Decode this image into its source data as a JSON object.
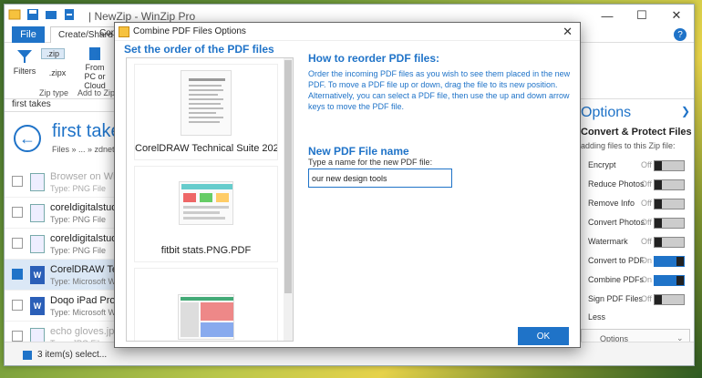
{
  "app": {
    "title": "| NewZip - WinZip Pro",
    "window_controls": [
      "—",
      "☐",
      "✕"
    ]
  },
  "ribbon": {
    "tab_file": "File",
    "tab_create_share": "Create/Share",
    "tab_copy": "Copy",
    "help": "?",
    "filters_label": "Filters",
    "zip_label": ".zip",
    "zipx_label": ".zipx",
    "from_pc_label": "From PC or Cloud",
    "group_zip_type": "Zip type",
    "group_add_to_zip": "Add to Zip"
  },
  "left_nav": {
    "tab_label": "first takes",
    "big_title": "first takes",
    "breadcrumb": "Files  »  ...  »  zdnet"
  },
  "files": [
    {
      "name": "Browser on Win",
      "type": "Type: PNG File",
      "icon": "image-file-icon",
      "dim": true,
      "selected": false
    },
    {
      "name": "coreldigitalstudio",
      "type": "Type: PNG File",
      "icon": "image-file-icon",
      "dim": false,
      "selected": false
    },
    {
      "name": "coreldigitalstudio",
      "type": "Type: PNG File",
      "icon": "image-file-icon",
      "dim": false,
      "selected": false
    },
    {
      "name": "CorelDRAW Techn",
      "type": "Type: Microsoft Word",
      "icon": "word-file-icon",
      "dim": false,
      "selected": true
    },
    {
      "name": "Doqo iPad Pro k",
      "type": "Type: Microsoft Word",
      "icon": "word-file-icon",
      "dim": false,
      "selected": false
    },
    {
      "name": "echo gloves.jpg",
      "type": "Type: JPG File",
      "icon": "image-file-icon",
      "dim": true,
      "selected": false
    }
  ],
  "status": {
    "text": "3 item(s) select..."
  },
  "right_panel": {
    "title": "Options",
    "subtitle": "Convert & Protect Files",
    "subtitle2": "adding files to this Zip file:",
    "toggles": [
      {
        "label": "Encrypt",
        "state": "Off",
        "on": false
      },
      {
        "label": "Reduce Photos",
        "state": "Off",
        "on": false
      },
      {
        "label": "Remove Info",
        "state": "Off",
        "on": false
      },
      {
        "label": "Convert Photos",
        "state": "Off",
        "on": false
      },
      {
        "label": "Watermark",
        "state": "Off",
        "on": false
      },
      {
        "label": "Convert to PDF",
        "state": "On",
        "on": true
      },
      {
        "label": "Combine PDFs",
        "state": "On",
        "on": true
      },
      {
        "label": "Sign PDF Files",
        "state": "Off",
        "on": false
      }
    ],
    "less": "Less",
    "options_btn": "Options"
  },
  "dialog": {
    "title": "Combine PDF Files Options",
    "close": "✕",
    "set_order_title": "Set the order of the PDF files",
    "pdf_items": [
      {
        "caption": "CorelDRAW Technical Suite 202..."
      },
      {
        "caption": "fitbit stats.PNG.PDF"
      },
      {
        "caption": ""
      }
    ],
    "how_title": "How to reorder PDF files:",
    "how_text": "Order the incoming PDF files as you wish to see them placed in the new PDF. To move a PDF file up or down, drag the file to its new position. Alternatively, you can select a PDF file, then use the up and down arrow keys to move the PDF file.",
    "new_title": "New PDF File name",
    "new_label": "Type a name for the new PDF file:",
    "new_value": "our new design tools",
    "ok": "OK"
  },
  "colors": {
    "accent": "#1f73c8",
    "selected_row": "#dbe8f6"
  }
}
